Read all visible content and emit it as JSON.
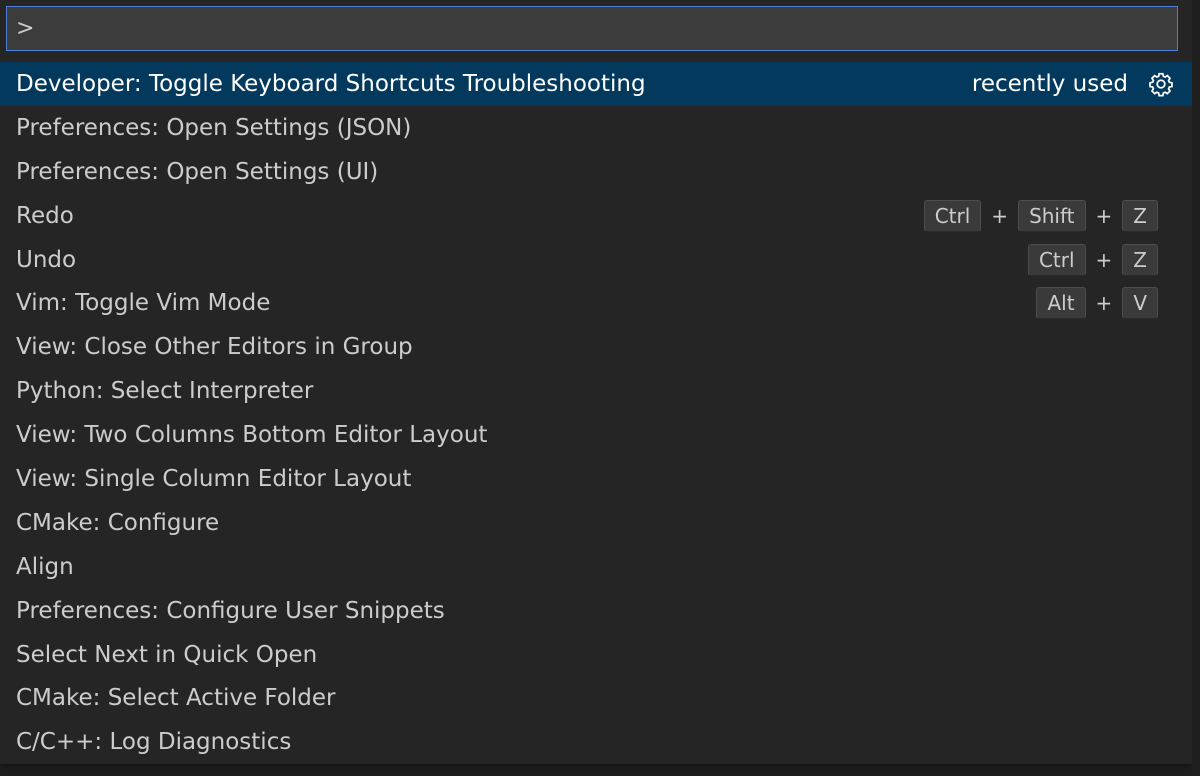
{
  "command_palette": {
    "input_value": ">",
    "items": [
      {
        "label": "Developer: Toggle Keyboard Shortcuts Troubleshooting",
        "badge": "recently used",
        "selected": true
      },
      {
        "label": "Preferences: Open Settings (JSON)"
      },
      {
        "label": "Preferences: Open Settings (UI)"
      },
      {
        "label": "Redo",
        "keys": [
          "Ctrl",
          "Shift",
          "Z"
        ]
      },
      {
        "label": "Undo",
        "keys": [
          "Ctrl",
          "Z"
        ]
      },
      {
        "label": "Vim: Toggle Vim Mode",
        "keys": [
          "Alt",
          "V"
        ]
      },
      {
        "label": "View: Close Other Editors in Group"
      },
      {
        "label": "Python: Select Interpreter"
      },
      {
        "label": "View: Two Columns Bottom Editor Layout"
      },
      {
        "label": "View: Single Column Editor Layout"
      },
      {
        "label": "CMake: Configure"
      },
      {
        "label": "Align"
      },
      {
        "label": "Preferences: Configure User Snippets"
      },
      {
        "label": "Select Next in Quick Open"
      },
      {
        "label": "CMake: Select Active Folder"
      },
      {
        "label": "C/C++: Log Diagnostics"
      }
    ],
    "key_separator": "+",
    "icons": {
      "configure": "gear-icon"
    }
  },
  "colors": {
    "selection": "#04395e",
    "input_border": "#4b80d6",
    "panel": "#252526"
  }
}
